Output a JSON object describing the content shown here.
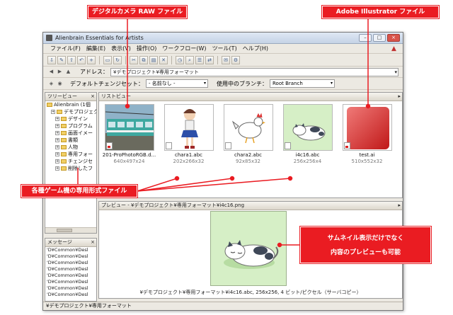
{
  "window": {
    "title": "Alienbrain Essentials for Artists",
    "buttons": [
      "–",
      "□",
      "×"
    ]
  },
  "menu": [
    "ファイル(F)",
    "編集(E)",
    "表示(V)",
    "操作(O)",
    "ワークフロー(W)",
    "ツール(T)",
    "ヘルプ(H)"
  ],
  "address": {
    "label": "アドレス：",
    "value": "¥デモプロジェクト¥専用フォーマット"
  },
  "branch": {
    "changeset_label": "デフォルトチェンジセット：",
    "changeset_value": "- 名前なし -",
    "branch_label": "使用中のブランチ：",
    "branch_value": "Root Branch"
  },
  "tree": {
    "header": "ツリービュー",
    "close": "×",
    "items": [
      {
        "label": "Alienbrain (1個",
        "level": 0
      },
      {
        "label": "デモプロジェクト",
        "level": 1
      },
      {
        "label": "デザイン",
        "level": 2
      },
      {
        "label": "プログラム",
        "level": 2
      },
      {
        "label": "画面イメー",
        "level": 2
      },
      {
        "label": "書類",
        "level": 2
      },
      {
        "label": "人物",
        "level": 2
      },
      {
        "label": "専用フォー",
        "level": 2
      },
      {
        "label": "チェンジセ",
        "level": 2
      },
      {
        "label": "削除したフ",
        "level": 2
      }
    ]
  },
  "messages": {
    "header": "メッセージ",
    "close": "×",
    "rows": [
      "'D¥Common¥Desl",
      "'D¥Common¥Desl",
      "'D¥Common¥Desl",
      "'D¥Common¥Desl",
      "'D¥Common¥Desl",
      "'D¥Common¥Desl",
      "'D¥Common¥Desl",
      "'D¥Common¥Desl"
    ]
  },
  "list": {
    "header": "リストビュー",
    "items": [
      {
        "name": "201-ProPhotoRGB.d...",
        "size": "640x497x24",
        "badge": "red"
      },
      {
        "name": "chara1.abc",
        "size": "202x266x32",
        "badge": "plain"
      },
      {
        "name": "chara2.abc",
        "size": "92x85x32",
        "badge": "plain"
      },
      {
        "name": "i4c16.abc",
        "size": "256x256x4",
        "badge": "plain"
      },
      {
        "name": "test.ai",
        "size": "510x552x32",
        "badge": "red"
      }
    ]
  },
  "preview": {
    "header": "プレビュー - ¥デモプロジェクト¥専用フォーマット¥i4c16.png",
    "caption": "¥デモプロジェクト¥専用フォーマット¥i4c16.abc, 256x256, 4 ビット/ピクセル（サーバコピー）"
  },
  "status": "¥デモプロジェクト¥専用フォーマット",
  "callouts": {
    "raw": "デジタルカメラ RAW ファイル",
    "ai": "Adobe Illustrator ファイル",
    "game": "各種ゲーム機の専用形式ファイル",
    "thumb_line1": "サムネイル表示だけでなく",
    "thumb_line2": "内容のプレビューも可能"
  },
  "colors": {
    "callout": "#ea1c22",
    "preview_bg": "#d6efc6",
    "ai_gradient_start": "#f07a78",
    "ai_gradient_end": "#c01818"
  }
}
